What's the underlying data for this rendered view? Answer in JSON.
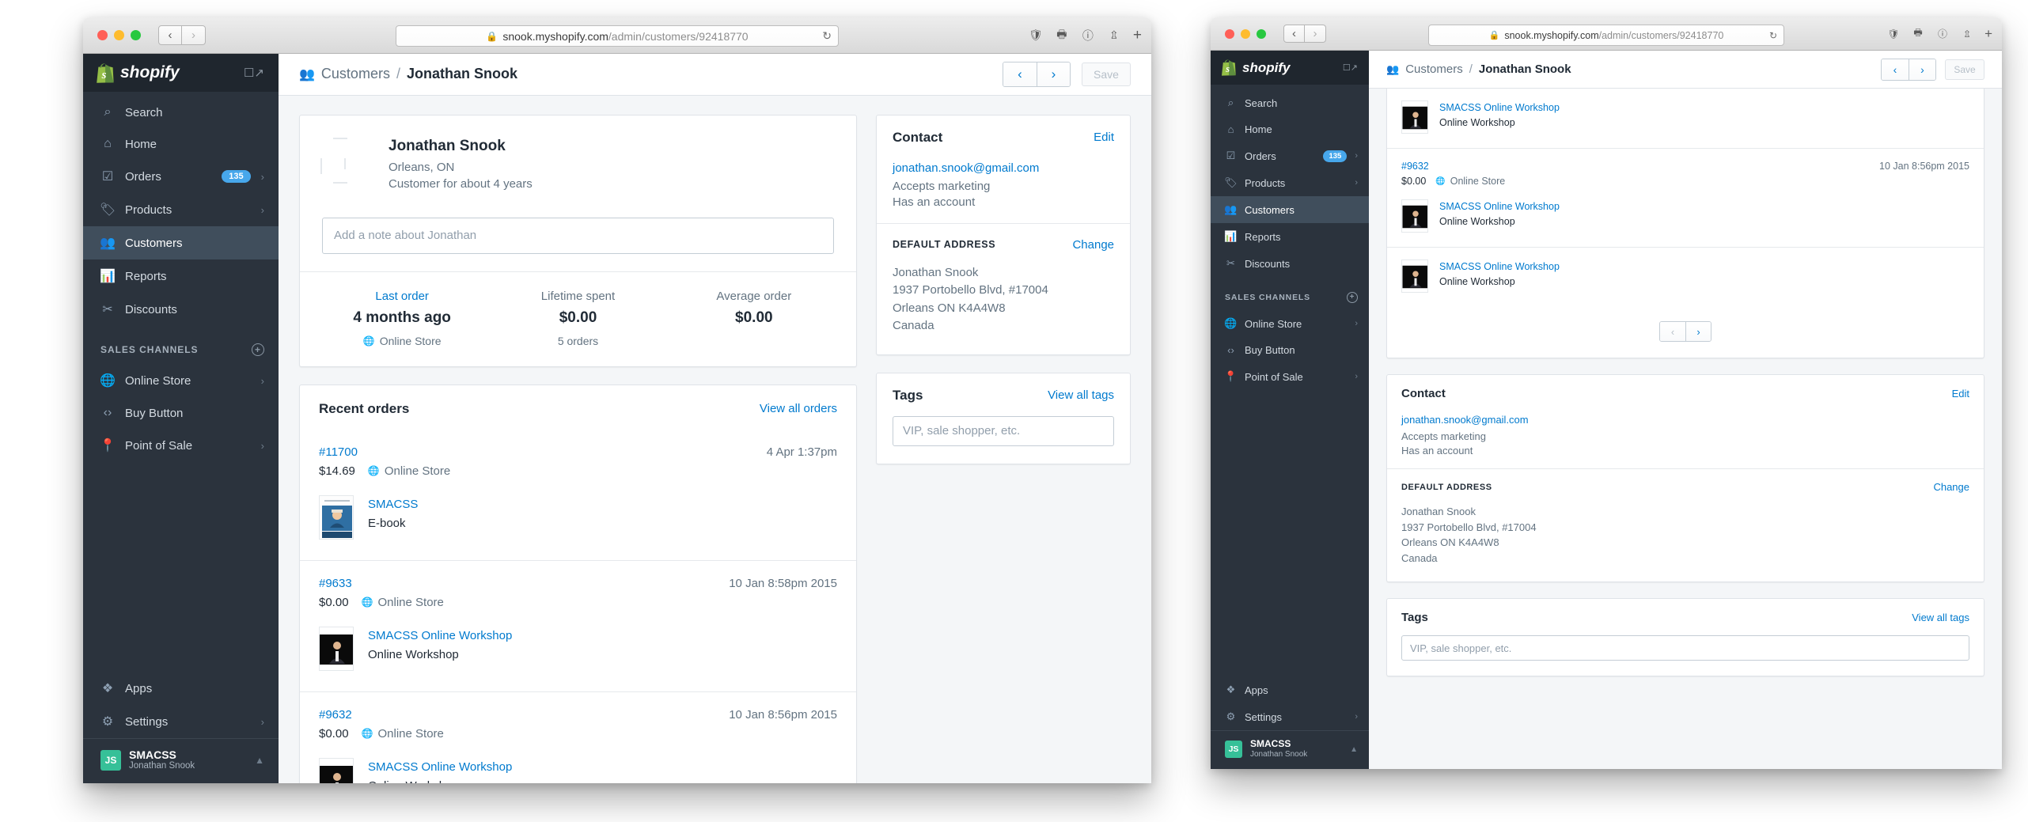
{
  "browser": {
    "url_secure_host": "snook.myshopify.com",
    "url_path": "/admin/customers/92418770",
    "lock_icon": "lock-icon",
    "reload_icon": "reload-icon",
    "back_icon": "chevron-left-icon",
    "forward_icon": "chevron-right-icon",
    "toolbar_icons": [
      "shield-icon",
      "print-icon",
      "info-icon",
      "share-icon"
    ],
    "new_tab_label": "+"
  },
  "sidebar": {
    "brand": "shopify",
    "brand_external_icon": "external-link-icon",
    "items": [
      {
        "label": "Search",
        "icon": "search-icon",
        "badge": "",
        "chevron": false,
        "active": false
      },
      {
        "label": "Home",
        "icon": "home-icon",
        "badge": "",
        "chevron": false,
        "active": false
      },
      {
        "label": "Orders",
        "icon": "orders-icon",
        "badge": "135",
        "chevron": true,
        "active": false
      },
      {
        "label": "Products",
        "icon": "tag-icon",
        "badge": "",
        "chevron": true,
        "active": false
      },
      {
        "label": "Customers",
        "icon": "customers-icon",
        "badge": "",
        "chevron": false,
        "active": true
      },
      {
        "label": "Reports",
        "icon": "reports-icon",
        "badge": "",
        "chevron": false,
        "active": false
      },
      {
        "label": "Discounts",
        "icon": "discounts-icon",
        "badge": "",
        "chevron": false,
        "active": false
      }
    ],
    "section_title": "SALES CHANNELS",
    "section_add_icon": "plus-circle-icon",
    "channels": [
      {
        "label": "Online Store",
        "icon": "globe-icon",
        "chevron": true
      },
      {
        "label": "Buy Button",
        "icon": "code-icon",
        "chevron": false
      },
      {
        "label": "Point of Sale",
        "icon": "pin-icon",
        "chevron": true
      }
    ],
    "bottom": [
      {
        "label": "Apps",
        "icon": "puzzle-icon",
        "chevron": false
      },
      {
        "label": "Settings",
        "icon": "gear-icon",
        "chevron": true
      }
    ],
    "account": {
      "initials": "JS",
      "store": "SMACSS",
      "user": "Jonathan Snook",
      "chevron_icon": "chevron-up-icon"
    }
  },
  "topbar": {
    "crumb_icon": "customers-icon",
    "crumb_parent": "Customers",
    "crumb_sep": "/",
    "crumb_current": "Jonathan Snook",
    "prev_icon": "chevron-left-icon",
    "next_icon": "chevron-right-icon",
    "save_label": "Save"
  },
  "customer": {
    "name": "Jonathan Snook",
    "location": "Orleans, ON",
    "tenure": "Customer for about 4 years",
    "note_placeholder": "Add a note about Jonathan",
    "stats": [
      {
        "label": "Last order",
        "label_link": true,
        "value": "4 months ago",
        "sub": "Online Store",
        "sub_icon": "globe-icon"
      },
      {
        "label": "Lifetime spent",
        "label_link": false,
        "value": "$0.00",
        "sub": "5 orders",
        "sub_icon": ""
      },
      {
        "label": "Average order",
        "label_link": false,
        "value": "$0.00",
        "sub": "",
        "sub_icon": ""
      }
    ]
  },
  "recent_orders": {
    "title": "Recent orders",
    "view_all": "View all orders",
    "orders": [
      {
        "number": "#11700",
        "price": "$14.69",
        "channel": "Online Store",
        "channel_icon": "globe-icon",
        "date": "4 Apr 1:37pm",
        "product": {
          "name": "SMACSS",
          "type": "E-book",
          "thumb": "smacss-book-cover"
        }
      },
      {
        "number": "#9633",
        "price": "$0.00",
        "channel": "Online Store",
        "channel_icon": "globe-icon",
        "date": "10 Jan 8:58pm 2015",
        "product": {
          "name": "SMACSS Online Workshop",
          "type": "Online Workshop",
          "thumb": "speaker-photo"
        }
      },
      {
        "number": "#9632",
        "price": "$0.00",
        "channel": "Online Store",
        "channel_icon": "globe-icon",
        "date": "10 Jan 8:56pm 2015",
        "product": {
          "name": "SMACSS Online Workshop",
          "type": "Online Workshop",
          "thumb": "speaker-photo"
        }
      }
    ],
    "pager_prev_icon": "chevron-left-icon",
    "pager_next_icon": "chevron-right-icon"
  },
  "contact": {
    "title": "Contact",
    "edit": "Edit",
    "email": "jonathan.snook@gmail.com",
    "marketing": "Accepts marketing",
    "account": "Has an account",
    "address_label": "DEFAULT ADDRESS",
    "change": "Change",
    "address_lines": [
      "Jonathan Snook",
      "1937 Portobello Blvd, #17004",
      "Orleans ON K4A4W8",
      "Canada"
    ]
  },
  "tags": {
    "title": "Tags",
    "view_all": "View all tags",
    "placeholder": "VIP, sale shopper, etc."
  },
  "colors": {
    "sidebar_bg": "#2b333d",
    "sidebar_active": "#404e5c",
    "link": "#007ace",
    "badge": "#47a7eb",
    "avatar": "#36c098",
    "page_bg": "#f4f6f8"
  }
}
